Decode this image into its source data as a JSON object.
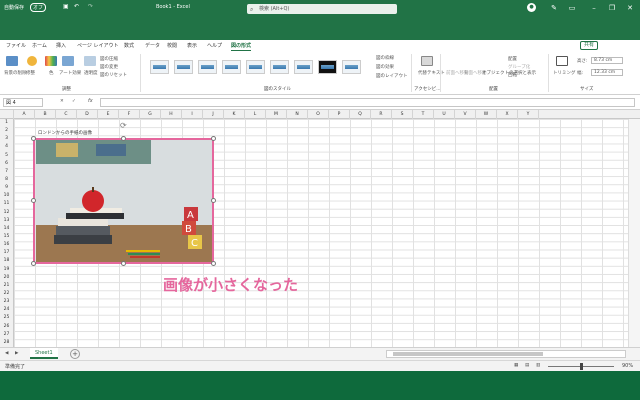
{
  "titlebar": {
    "autosave": "自動保存",
    "autosave_state": "オフ",
    "filename": "Book1 - Excel",
    "search_placeholder": "検索 (Alt+Q)"
  },
  "menu": {
    "tabs": [
      "ファイル",
      "ホーム",
      "挿入",
      "ページ レイアウト",
      "数式",
      "データ",
      "校閲",
      "表示",
      "ヘルプ",
      "図の形式"
    ],
    "active": "図の形式",
    "share": "共有"
  },
  "ribbon": {
    "remove_bg": "背景の削除",
    "corrections": "修整",
    "color": "色",
    "artistic": "アート効果",
    "transparency": "透明度",
    "compress": "図の圧縮",
    "change": "図の変更",
    "reset": "図のリセット",
    "group_adjust": "調整",
    "group_styles": "図のスタイル",
    "border": "図の枠線",
    "effects": "図の効果",
    "layout": "図のレイアウト",
    "group_access": "アクセシビ...",
    "alt_text": "代替テキスト",
    "forward": "前面へ移動",
    "backward": "背面へ移動",
    "selection_pane": "オブジェクトの選択と表示",
    "align": "配置",
    "group": "グループ化",
    "rotate": "回転",
    "group_arrange": "配置",
    "crop": "トリミング",
    "height_label": "高さ:",
    "height": "8.73 cm",
    "width_label": "幅:",
    "width": "12.33 cm",
    "group_size": "サイズ"
  },
  "namebox": "図 4",
  "fx": "fx",
  "columns": [
    "A",
    "B",
    "C",
    "D",
    "E",
    "F",
    "G",
    "H",
    "I",
    "J",
    "K",
    "L",
    "M",
    "N",
    "O",
    "P",
    "Q",
    "R",
    "S",
    "T",
    "U",
    "V",
    "W",
    "X",
    "Y"
  ],
  "rows": [
    "1",
    "2",
    "3",
    "4",
    "5",
    "6",
    "7",
    "8",
    "9",
    "10",
    "11",
    "12",
    "13",
    "14",
    "15",
    "16",
    "17",
    "18",
    "19",
    "20",
    "21",
    "22",
    "23",
    "24",
    "25",
    "26",
    "27",
    "28"
  ],
  "cell_a2": "ロンドンからの手紙の画像",
  "caption": "画像が小さくなった",
  "sheet": "Sheet1",
  "status": "準備完了",
  "zoom": "90%",
  "colors": {
    "excel_green": "#217346",
    "accent_pink": "#e5679d"
  }
}
